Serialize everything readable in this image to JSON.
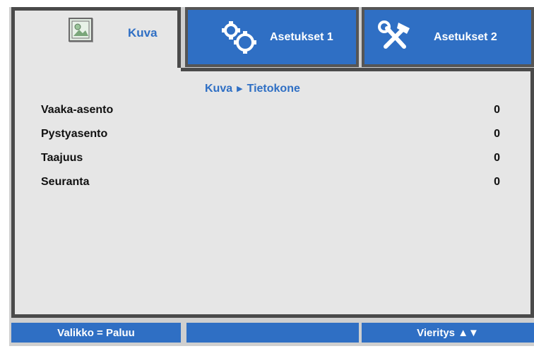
{
  "tabs": {
    "active": {
      "label": "Kuva",
      "icon": "picture-icon"
    },
    "settings1": {
      "label": "Asetukset 1",
      "icon": "gears-icon"
    },
    "settings2": {
      "label": "Asetukset 2",
      "icon": "tools-icon"
    }
  },
  "breadcrumb": {
    "parent": "Kuva",
    "separator": "▶",
    "current": "Tietokone"
  },
  "rows": [
    {
      "label": "Vaaka-asento",
      "value": "0"
    },
    {
      "label": "Pystyasento",
      "value": "0"
    },
    {
      "label": "Taajuus",
      "value": "0"
    },
    {
      "label": "Seuranta",
      "value": "0"
    }
  ],
  "footer": {
    "menu_hint": "Valikko = Paluu",
    "middle": "",
    "scroll_hint": "Vieritys ▲▼"
  },
  "colors": {
    "accent": "#2f6fc4",
    "panel": "#e6e6e6",
    "border": "#4a4a4a"
  }
}
